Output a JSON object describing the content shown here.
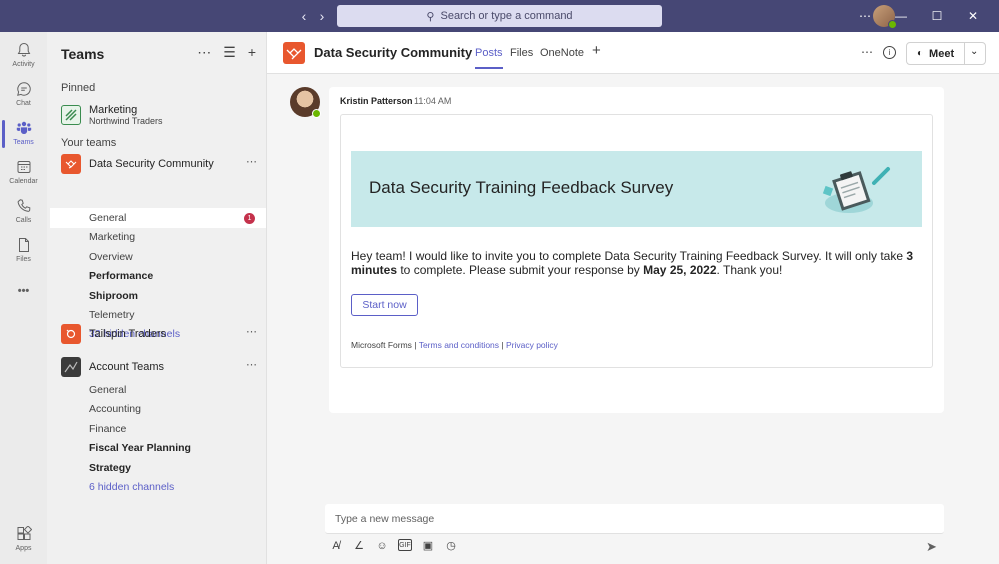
{
  "titlebar": {
    "search_placeholder": "Search or type a command"
  },
  "rail": {
    "items": [
      {
        "label": "Activity"
      },
      {
        "label": "Chat"
      },
      {
        "label": "Teams"
      },
      {
        "label": "Calendar"
      },
      {
        "label": "Calls"
      },
      {
        "label": "Files"
      },
      {
        "label": "Apps"
      }
    ],
    "more": "•••"
  },
  "panel": {
    "title": "Teams",
    "pinned_label": "Pinned",
    "pinned": {
      "name": "Marketing",
      "sub": "Northwind Traders"
    },
    "your_teams_label": "Your teams",
    "teams": [
      {
        "name": "Data Security Community",
        "channels": [
          "General",
          "Marketing",
          "Overview",
          "Performance",
          "Shiproom",
          "Telemetry"
        ],
        "hidden": "32 hidden channels"
      },
      {
        "name": "Tailspin Traders"
      },
      {
        "name": "Account Teams",
        "channels": [
          "General",
          "Accounting",
          "Finance",
          "Fiscal Year Planning",
          "Strategy"
        ],
        "hidden": "6 hidden channels"
      }
    ],
    "badge": "1"
  },
  "header": {
    "title": "Data Security Community",
    "tabs": [
      "Posts",
      "Files",
      "OneNote"
    ],
    "meet_label": "Meet"
  },
  "post": {
    "author": "Kristin Patterson",
    "time": "11:04 AM",
    "card": {
      "banner_title": "Data Security Training Feedback Survey",
      "body_1": "Hey team! I would like to invite you to complete Data Security Training Feedback Survey. It will only take ",
      "body_minutes": "3 minutes",
      "body_2": " to complete. Please submit your response by ",
      "body_date": "May 25, 2022",
      "body_3": ". Thank you!",
      "button": "Start now",
      "footer_source": "Microsoft Forms | ",
      "footer_terms": "Terms and conditions",
      "footer_sep": " | ",
      "footer_privacy": "Privacy policy"
    }
  },
  "compose": {
    "placeholder": "Type a new message"
  },
  "colors": {
    "titlebar": "#464775",
    "accent": "#5b5fc7",
    "team_orange": "#e8572e",
    "banner": "#c7e9ea",
    "presence": "#6bb700",
    "badge": "#c4314b"
  }
}
